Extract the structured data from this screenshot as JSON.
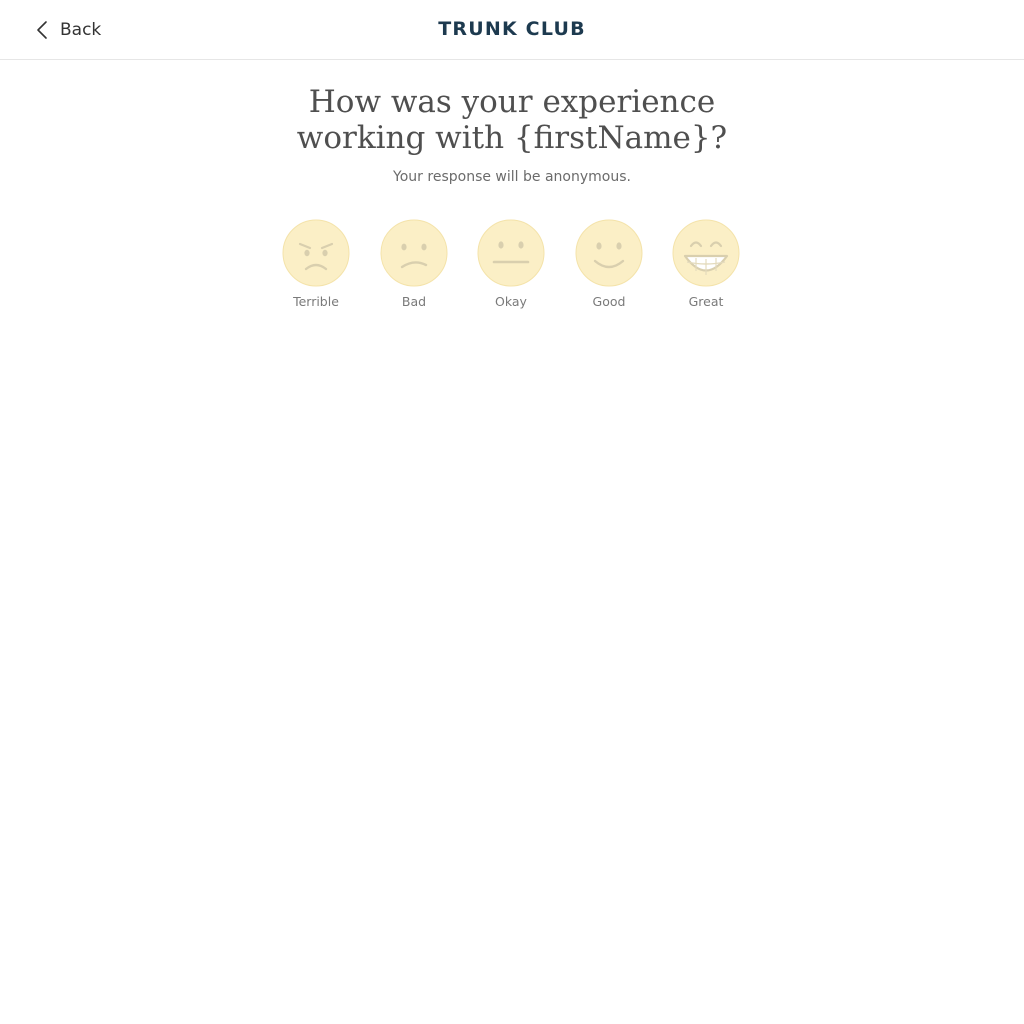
{
  "header": {
    "back_label": "Back",
    "brand": "TRUNK CLUB"
  },
  "survey": {
    "question_line1": "How was your experience",
    "question_line2": "working with {firstName}?",
    "subtitle": "Your response will be anonymous.",
    "options": [
      {
        "label": "Terrible",
        "icon": "angry-face-icon"
      },
      {
        "label": "Bad",
        "icon": "frowning-face-icon"
      },
      {
        "label": "Okay",
        "icon": "neutral-face-icon"
      },
      {
        "label": "Good",
        "icon": "smiling-face-icon"
      },
      {
        "label": "Great",
        "icon": "grinning-face-icon"
      }
    ]
  },
  "colors": {
    "brand": "#1d3a4f",
    "emoji_face": "#fbefc6",
    "emoji_features": "#d9cfae"
  }
}
